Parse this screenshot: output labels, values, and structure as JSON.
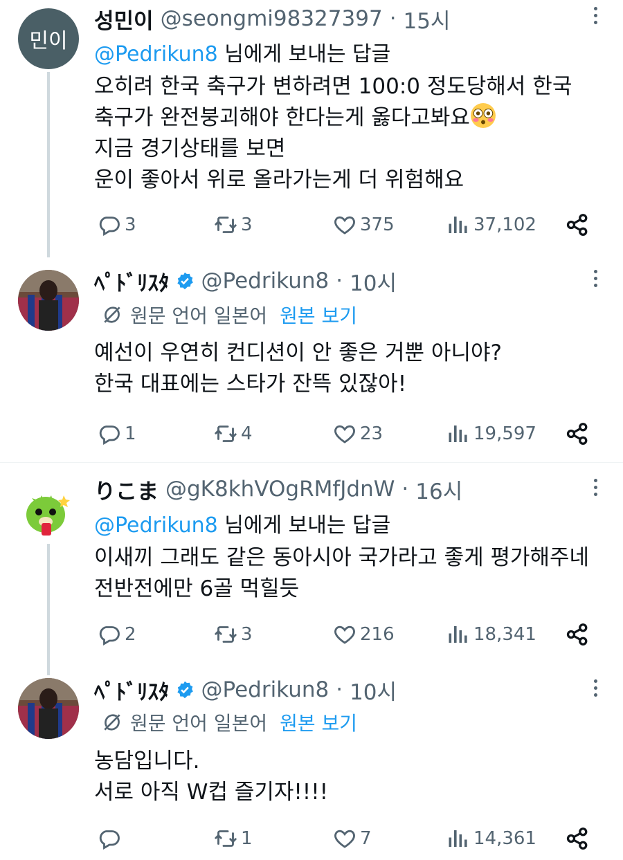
{
  "tweets": [
    {
      "name": "성민이",
      "avatar_text": "민이",
      "handle": "@seongmi98327397",
      "time": "15시",
      "reply_prefix": "@Pedrikun8",
      "reply_suffix": " 님에게 보내는 답글",
      "lines": [
        "오히려 한국 축구가 변하려면 100:0 정도당해서 한국",
        "축구가 완전붕괴해야 한다는게 옳다고봐요",
        "지금 경기상태를 보면",
        "운이 좋아서 위로 올라가는게 더 위험해요"
      ],
      "replies": "3",
      "retweets": "3",
      "likes": "375",
      "views": "37,102"
    },
    {
      "name": "ﾍﾟﾄﾞﾘｽﾀ",
      "handle": "@Pedrikun8",
      "time": "10시",
      "translation_label": "원문 언어 일본어",
      "translation_link": "원본 보기",
      "lines": [
        "예선이 우연히 컨디션이 안 좋은 거뿐 아니야?",
        "한국 대표에는 스타가 잔뜩 있잖아!"
      ],
      "replies": "1",
      "retweets": "4",
      "likes": "23",
      "views": "19,597"
    },
    {
      "name": "りこま",
      "handle": "@gK8khVOgRMfJdnW",
      "time": "16시",
      "reply_prefix": "@Pedrikun8",
      "reply_suffix": " 님에게 보내는 답글",
      "lines": [
        "이새끼 그래도 같은 동아시아 국가라고 좋게 평가해주네",
        "전반전에만 6골 먹힐듯"
      ],
      "replies": "2",
      "retweets": "3",
      "likes": "216",
      "views": "18,341"
    },
    {
      "name": "ﾍﾟﾄﾞﾘｽﾀ",
      "handle": "@Pedrikun8",
      "time": "10시",
      "translation_label": "원문 언어 일본어",
      "translation_link": "원본 보기",
      "lines": [
        "농담입니다.",
        "서로 아직 W컵 즐기자!!!!"
      ],
      "replies": "",
      "retweets": "1",
      "likes": "7",
      "views": "14,361"
    }
  ],
  "separator": "·",
  "colors": {
    "accent": "#1d9bf0",
    "muted": "#536471",
    "line": "#cfd9de"
  },
  "icons": [
    "reply-icon",
    "retweet-icon",
    "like-icon",
    "views-icon",
    "share-icon",
    "more-icon",
    "verified-icon",
    "translate-icon",
    "flushed-emoji-icon"
  ]
}
